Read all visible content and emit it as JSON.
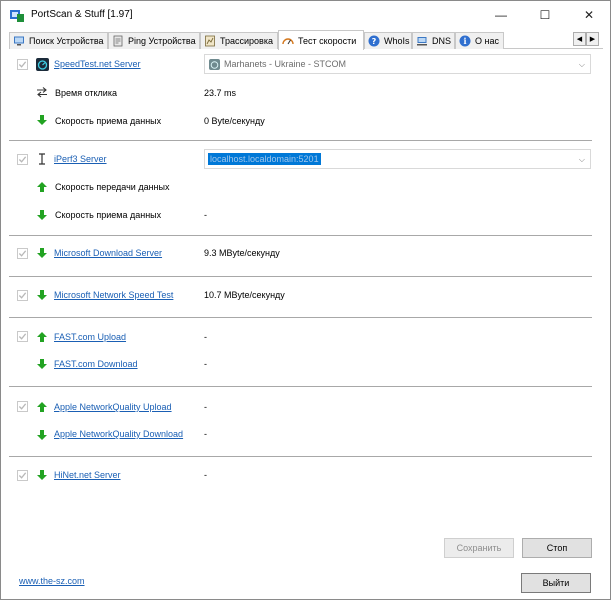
{
  "window": {
    "title": "PortScan & Stuff [1.97]",
    "minimize": "—",
    "maximize": "☐",
    "close": "✕"
  },
  "tabs": [
    {
      "label": "Поиск Устройства",
      "icon": "monitor-icon"
    },
    {
      "label": "Ping Устройства",
      "icon": "ping-icon"
    },
    {
      "label": "Трассировка",
      "icon": "route-icon"
    },
    {
      "label": "Тест скорости",
      "icon": "speedometer-icon",
      "active": true
    },
    {
      "label": "WhoIs",
      "icon": "help-icon"
    },
    {
      "label": "DNS",
      "icon": "dns-icon"
    },
    {
      "label": "О нас",
      "icon": "info-icon"
    }
  ],
  "tab_scroll": {
    "left": "◀",
    "right": "▶"
  },
  "speedtest": {
    "name": "SpeedTest.net Server",
    "server": "Marhanets - Ukraine - STCOM",
    "latency_label": "Время отклика",
    "latency_value": "23.7 ms",
    "download_label": "Скорость приема данных",
    "download_value": "0 Byte/секунду"
  },
  "iperf": {
    "name": "iPerf3 Server",
    "server": "localhost.localdomain:5201",
    "upload_label": "Скорость передачи данных",
    "upload_value": "",
    "download_label": "Скорость приема данных",
    "download_value": "-"
  },
  "microsoft_download": {
    "name": "Microsoft Download Server",
    "value": "9.3 MByte/секунду"
  },
  "microsoft_network": {
    "name": "Microsoft Network Speed Test",
    "value": "10.7 MByte/секунду"
  },
  "fast_upload": {
    "name": "FAST.com Upload",
    "value": "-"
  },
  "fast_download": {
    "name": "FAST.com Download",
    "value": "-"
  },
  "apple_upload": {
    "name": "Apple NetworkQuality Upload",
    "value": "-"
  },
  "apple_download": {
    "name": "Apple NetworkQuality Download",
    "value": "-"
  },
  "hinet": {
    "name": "HiNet.net Server",
    "value": "-"
  },
  "buttons": {
    "save": "Сохранить",
    "stop": "Стоп",
    "exit": "Выйти"
  },
  "footer": {
    "link": "www.the-sz.com"
  },
  "colors": {
    "link": "#1a5fb4",
    "arrow_green": "#22a322",
    "selection": "#0078d7"
  }
}
